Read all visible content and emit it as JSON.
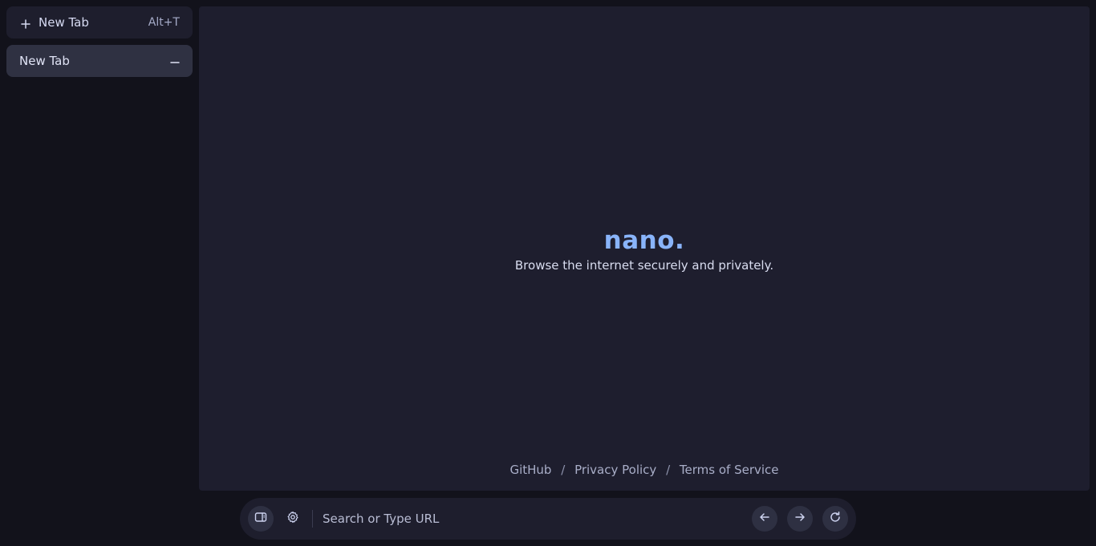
{
  "sidebar": {
    "new_tab": {
      "label": "New Tab",
      "shortcut": "Alt+T",
      "icon": "plus-icon"
    },
    "tabs": [
      {
        "label": "New Tab",
        "close_icon": "minus-icon"
      }
    ]
  },
  "content": {
    "brand": "nano.",
    "tagline": "Browse the internet securely and privately.",
    "footer_links": [
      "GitHub",
      "Privacy Policy",
      "Terms of Service"
    ],
    "footer_separator": "/"
  },
  "bottombar": {
    "url_placeholder": "Search or Type URL",
    "url_value": "",
    "icons": [
      "sidebar-toggle-icon",
      "gear-icon",
      "arrow-left-icon",
      "arrow-right-icon",
      "reload-icon"
    ]
  },
  "colors": {
    "background": "#12121b",
    "panel": "#1e1e2e",
    "accent": "#89b4fa",
    "active_tab": "#2f3142"
  }
}
